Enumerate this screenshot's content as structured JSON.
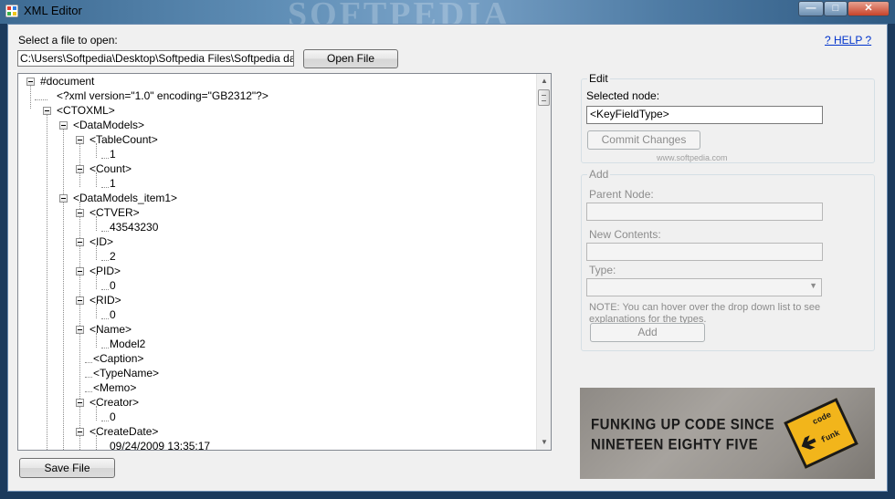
{
  "window": {
    "title": "XML Editor",
    "watermark": "SOFTPEDIA"
  },
  "file": {
    "select_label": "Select a file to open:",
    "path": "C:\\Users\\Softpedia\\Desktop\\Softpedia Files\\Softpedia databas",
    "open_button": "Open File",
    "help_link": "? HELP ?"
  },
  "tree": [
    "#document",
    "<?xml version=\"1.0\" encoding=\"GB2312\"?>",
    "<CTOXML>",
    "<DataModels>",
    "<TableCount>",
    "1",
    "<Count>",
    "1",
    "<DataModels_item1>",
    "<CTVER>",
    "43543230",
    "<ID>",
    "2",
    "<PID>",
    "0",
    "<RID>",
    "0",
    "<Name>",
    "Model2",
    "<Caption>",
    "<TypeName>",
    "<Memo>",
    "<Creator>",
    "0",
    "<CreateDate>",
    "09/24/2009 13:35:17"
  ],
  "edit": {
    "title": "Edit",
    "selected_label": "Selected node:",
    "selected_value": "<KeyFieldType>",
    "commit_button": "Commit Changes",
    "watermark": "www.softpedia.com"
  },
  "add": {
    "title": "Add",
    "parent_label": "Parent Node:",
    "contents_label": "New Contents:",
    "type_label": "Type:",
    "note": "NOTE: You can hover over the drop down list to see explanations for the types.",
    "add_button": "Add"
  },
  "banner": {
    "line1": "FUNKING UP CODE SINCE",
    "line2": "NINETEEN EIGHTY FIVE",
    "sign_word1": "code",
    "sign_word2": "funk"
  },
  "save_button": "Save File"
}
